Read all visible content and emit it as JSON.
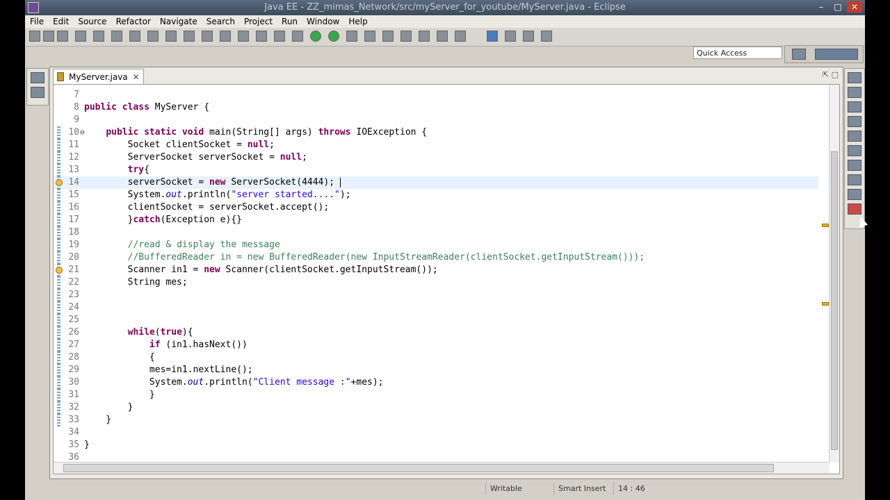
{
  "window": {
    "title": "Java EE - ZZ_mimas_Network/src/myServer_for_youtube/MyServer.java - Eclipse",
    "minimize": "–",
    "maximize": "□",
    "close": "✕"
  },
  "menu": [
    "File",
    "Edit",
    "Source",
    "Refactor",
    "Navigate",
    "Search",
    "Project",
    "Run",
    "Window",
    "Help"
  ],
  "quick_access": {
    "placeholder": "Quick Access"
  },
  "editor": {
    "tab_label": "MyServer.java",
    "tab_close": "✕",
    "view_menu": "⇱ □",
    "lines": [
      {
        "num": "7",
        "html": ""
      },
      {
        "num": "8",
        "html": "<span class=\"kw\">public</span> <span class=\"kw\">class</span> MyServer {"
      },
      {
        "num": "9",
        "html": ""
      },
      {
        "num": "10",
        "html": "    <span class=\"kw\">public</span> <span class=\"kw\">static</span> <span class=\"kw\">void</span> main(String[] args) <span class=\"kw\">throws</span> IOException {"
      },
      {
        "num": "11",
        "html": "        Socket clientSocket = <span class=\"kw\">null</span>;"
      },
      {
        "num": "12",
        "html": "        ServerSocket serverSocket = <span class=\"kw\">null</span>;"
      },
      {
        "num": "13",
        "html": "        <span class=\"kw\">try</span>{"
      },
      {
        "num": "14",
        "html": "        serverSocket = <span class=\"kw\">new</span> ServerSocket(4444); <span class=\"caret\"></span>"
      },
      {
        "num": "15",
        "html": "        System.<span class=\"it\">out</span>.println(<span class=\"str\">\"server started....\"</span>);"
      },
      {
        "num": "16",
        "html": "        clientSocket = serverSocket.accept();"
      },
      {
        "num": "17",
        "html": "        }<span class=\"kw\">catch</span>(Exception e){}"
      },
      {
        "num": "18",
        "html": ""
      },
      {
        "num": "19",
        "html": "        <span class=\"cm\">//read &amp; display the message</span>"
      },
      {
        "num": "20",
        "html": "        <span class=\"cm\">//BufferedReader in = new BufferedReader(new InputStreamReader(clientSocket.getInputStream()));</span>"
      },
      {
        "num": "21",
        "html": "        Scanner in1 = <span class=\"kw\">new</span> Scanner(clientSocket.getInputStream());"
      },
      {
        "num": "22",
        "html": "        String mes;"
      },
      {
        "num": "23",
        "html": ""
      },
      {
        "num": "24",
        "html": ""
      },
      {
        "num": "25",
        "html": ""
      },
      {
        "num": "26",
        "html": "        <span class=\"kw\">while</span>(<span class=\"kw\">true</span>){"
      },
      {
        "num": "27",
        "html": "            <span class=\"kw\">if</span> (in1.hasNext())"
      },
      {
        "num": "28",
        "html": "            {"
      },
      {
        "num": "29",
        "html": "            mes=in1.nextLine();"
      },
      {
        "num": "30",
        "html": "            System.<span class=\"it\">out</span>.println(<span class=\"str\">\"Client message :\"</span>+mes);"
      },
      {
        "num": "31",
        "html": "            }"
      },
      {
        "num": "32",
        "html": "        }"
      },
      {
        "num": "33",
        "html": "    }"
      },
      {
        "num": "34",
        "html": ""
      },
      {
        "num": "35",
        "html": "}"
      },
      {
        "num": "36",
        "html": ""
      }
    ]
  },
  "status": {
    "writable": "Writable",
    "insert_mode": "Smart Insert",
    "cursor_position": "14 : 46"
  },
  "colors": {
    "keyword": "#7f0055",
    "string": "#2a00ff",
    "comment": "#3f7f5f",
    "field": "#0000c0"
  }
}
